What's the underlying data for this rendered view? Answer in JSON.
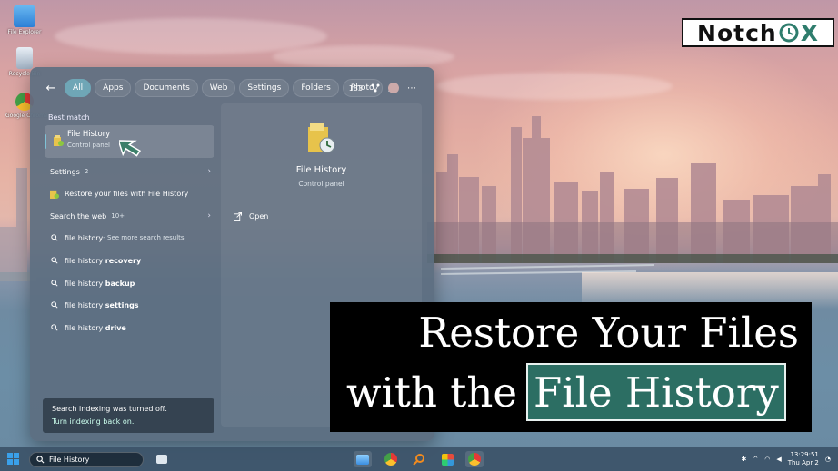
{
  "logo": {
    "prefix": "Notch",
    "suffix": "X"
  },
  "desktop_icons": [
    {
      "label": "File Explorer"
    },
    {
      "label": "Recycle Bin"
    },
    {
      "label": "Google Chrome"
    }
  ],
  "search_panel": {
    "filters": [
      {
        "label": "All",
        "active": true
      },
      {
        "label": "Apps"
      },
      {
        "label": "Documents"
      },
      {
        "label": "Web"
      },
      {
        "label": "Settings"
      },
      {
        "label": "Folders"
      },
      {
        "label": "Photo"
      }
    ],
    "points": "183",
    "best_match": {
      "heading": "Best match",
      "title": "File History",
      "subtitle": "Control panel"
    },
    "settings": {
      "heading": "Settings",
      "count": "2",
      "item": "Restore your files with File History"
    },
    "web": {
      "heading": "Search the web",
      "count": "10+",
      "items": [
        {
          "prefix": "file history",
          "suffix": " - See more search results"
        },
        {
          "prefix": "file history ",
          "bold": "recovery"
        },
        {
          "prefix": "file history ",
          "bold": "backup"
        },
        {
          "prefix": "file history ",
          "bold": "settings"
        },
        {
          "prefix": "file history ",
          "bold": "drive"
        }
      ]
    },
    "preview": {
      "title": "File History",
      "subtitle": "Control panel",
      "action": "Open"
    },
    "indexing": {
      "line1": "Search indexing was turned off.",
      "line2": "Turn indexing back on."
    }
  },
  "banner": {
    "line1": "Restore Your Files",
    "line2_prefix": "with the",
    "line2_highlight": "File History"
  },
  "taskbar": {
    "search_value": "File History",
    "time": "13:29:51",
    "date": "Thu Apr 2"
  },
  "colors": {
    "accent_chip": "#6fa6b6",
    "banner_highlight": "#2c6e63",
    "logo_accent": "#2f7d6d"
  }
}
